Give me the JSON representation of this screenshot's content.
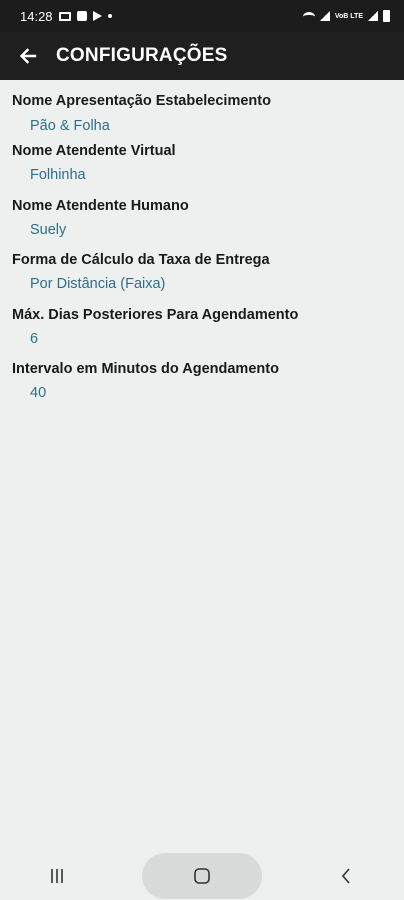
{
  "status_bar": {
    "time": "14:28",
    "lte_label": "VoB LTE"
  },
  "app_bar": {
    "title": "CONFIGURAÇÕES"
  },
  "settings": [
    {
      "label": "Nome Apresentação Estabelecimento",
      "value": "Pão & Folha"
    },
    {
      "label": "Nome Atendente Virtual",
      "value": "Folhinha"
    },
    {
      "label": "Nome Atendente Humano",
      "value": "Suely"
    },
    {
      "label": "Forma de Cálculo da Taxa de Entrega",
      "value": "Por Distância (Faixa)"
    },
    {
      "label": "Máx. Dias Posteriores Para Agendamento",
      "value": "6"
    },
    {
      "label": "Intervalo em Minutos do Agendamento",
      "value": "40"
    }
  ],
  "colors": {
    "app_bar": "#1f1f1f",
    "background": "#eef0f0",
    "value_text": "#2d6f8a",
    "label_text": "#1a1a1a"
  },
  "icons": {
    "back": "arrow-left-icon",
    "nav_recents": "recents-icon",
    "nav_home": "home-icon",
    "nav_back": "chevron-left-icon"
  }
}
